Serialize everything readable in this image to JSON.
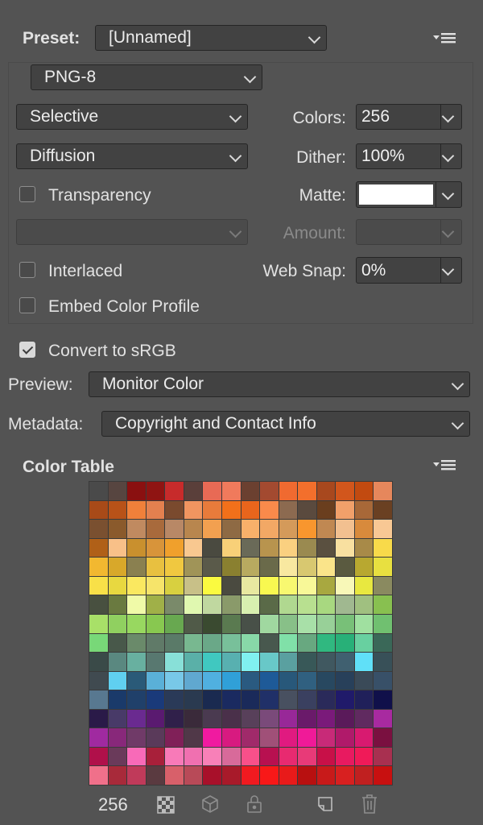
{
  "preset": {
    "label": "Preset:",
    "value": "[Unnamed]",
    "menu_icon": "panel-menu-icon"
  },
  "format": {
    "value": "PNG-8"
  },
  "reduction": {
    "value": "Selective"
  },
  "colors": {
    "label": "Colors:",
    "value": "256"
  },
  "dither_algo": {
    "value": "Diffusion"
  },
  "dither": {
    "label": "Dither:",
    "value": "100%"
  },
  "transparency": {
    "label": "Transparency",
    "checked": false
  },
  "matte": {
    "label": "Matte:",
    "color": "#ffffff"
  },
  "trans_dither": {
    "value": ""
  },
  "amount": {
    "label": "Amount:",
    "value": ""
  },
  "interlaced": {
    "label": "Interlaced",
    "checked": false
  },
  "web_snap": {
    "label": "Web Snap:",
    "value": "0%"
  },
  "embed_profile": {
    "label": "Embed Color Profile",
    "checked": false
  },
  "convert_srgb": {
    "label": "Convert to sRGB",
    "checked": true
  },
  "preview": {
    "label": "Preview:",
    "value": "Monitor Color"
  },
  "metadata": {
    "label": "Metadata:",
    "value": "Copyright and Contact Info"
  },
  "color_table": {
    "title": "Color Table",
    "count": "256",
    "colors": [
      "#4a4a4a",
      "#574540",
      "#8a1010",
      "#8f1412",
      "#c72b2b",
      "#5a3f3a",
      "#e86a55",
      "#f07a5c",
      "#6b4030",
      "#a34a30",
      "#f06a30",
      "#f36f2c",
      "#a8481e",
      "#d2561c",
      "#c24a10",
      "#e6875c",
      "#a84a18",
      "#b85218",
      "#f0803a",
      "#e3804f",
      "#7a4a2e",
      "#f09560",
      "#e87b3b",
      "#f2701a",
      "#e8651c",
      "#fa8a4b",
      "#8c6a50",
      "#5a4a3e",
      "#6a3e1e",
      "#f2a06a",
      "#a86838",
      "#6a4022",
      "#7a5030",
      "#8a5a2c",
      "#c08a60",
      "#a86a3c",
      "#b88866",
      "#b8864e",
      "#f2a050",
      "#8e6a44",
      "#f8b06a",
      "#f2a865",
      "#d49a5a",
      "#f8962e",
      "#c08852",
      "#f2c090",
      "#d88a3c",
      "#f8c894",
      "#b06018",
      "#f8c088",
      "#c9902e",
      "#d8943a",
      "#f0a02c",
      "#f8c890",
      "#4a4a40",
      "#f8d078",
      "#6a6a58",
      "#b8944e",
      "#fad080",
      "#9a8a50",
      "#5a5040",
      "#f8e0a0",
      "#a88a48",
      "#f8da4a",
      "#f2b830",
      "#d8a82a",
      "#8a8050",
      "#e8c040",
      "#f0c840",
      "#a09458",
      "#5a5a4a",
      "#8a8030",
      "#b8aa60",
      "#6a6a4a",
      "#f8e8a0",
      "#d8c870",
      "#fae48a",
      "#5a5a40",
      "#b8a830",
      "#e8e040",
      "#f8e048",
      "#e8d840",
      "#fae860",
      "#f6e46a",
      "#d8d040",
      "#c8c088",
      "#fafa40",
      "#4a4a40",
      "#e8e8a0",
      "#f8f850",
      "#f8f870",
      "#f8f898",
      "#a8a840",
      "#f8f8b8",
      "#e8e840",
      "#8a8a60",
      "#485040",
      "#6a7a40",
      "#f0faa8",
      "#a0b048",
      "#7a8a6a",
      "#e0f8b0",
      "#c0d8a0",
      "#8a9a6a",
      "#d8f0b0",
      "#5a6a48",
      "#b0d890",
      "#b8e090",
      "#a8d880",
      "#a0b890",
      "#a0c080",
      "#88c050",
      "#a8e068",
      "#90d060",
      "#98d860",
      "#88c850",
      "#68a850",
      "#505a48",
      "#3a4a30",
      "#5a7a50",
      "#485048",
      "#a0d8a0",
      "#88c088",
      "#a8e0a8",
      "#98d098",
      "#78c078",
      "#a0e0a0",
      "#70c070",
      "#78d878",
      "#48584a",
      "#6a8a6a",
      "#607a68",
      "#5a7a68",
      "#78b890",
      "#6aa888",
      "#78c09a",
      "#88d8a8",
      "#48584e",
      "#80e0a8",
      "#68a880",
      "#30b880",
      "#28b078",
      "#68d0a0",
      "#3a6858",
      "#3a4a48",
      "#5a8880",
      "#68b0a0",
      "#587870",
      "#88e0d8",
      "#5ab0a8",
      "#40c8c0",
      "#58b0b0",
      "#80f0f0",
      "#68c8c8",
      "#5aa0a0",
      "#385858",
      "#405860",
      "#406070",
      "#60e0f8",
      "#385058",
      "#404a50",
      "#60d0f0",
      "#2a5a78",
      "#5ab0d8",
      "#78c8e8",
      "#60a8d0",
      "#50b0e0",
      "#30a0d8",
      "#2a5a80",
      "#1e5a98",
      "#28587a",
      "#306080",
      "#284860",
      "#28405a",
      "#3a4a58",
      "#385068",
      "#587890",
      "#1a3a6a",
      "#20406a",
      "#1a3a7a",
      "#2a3a58",
      "#2a3a50",
      "#1a2a50",
      "#1a2a60",
      "#1a2a5a",
      "#203068",
      "#485060",
      "#3a4060",
      "#2a2a5a",
      "#201a6a",
      "#20205a",
      "#10104a",
      "#2a1a48",
      "#483a68",
      "#6a2a90",
      "#5a1a70",
      "#30204a",
      "#3a2a3a",
      "#4a3a50",
      "#4a304a",
      "#58405a",
      "#7a4a7a",
      "#982898",
      "#6a1a6a",
      "#7a1a7a",
      "#5a1a5a",
      "#602a60",
      "#a82aa0",
      "#a02aa0",
      "#88287a",
      "#703a68",
      "#5a3a5a",
      "#802058",
      "#503848",
      "#f01aa0",
      "#d81a80",
      "#a02a6a",
      "#a05078",
      "#e01a80",
      "#f01a98",
      "#c82a78",
      "#b01a6a",
      "#d81a70",
      "#7a1040",
      "#b0104a",
      "#6a3a5a",
      "#f86ab8",
      "#a8203a",
      "#f87ab8",
      "#f070b0",
      "#f880b8",
      "#d86a9a",
      "#f8508a",
      "#b81050",
      "#e82a70",
      "#e83a78",
      "#c81048",
      "#e81a60",
      "#f01a58",
      "#a83050",
      "#f0708a",
      "#a82a3a",
      "#c03a5a",
      "#5a3a40",
      "#d8606a",
      "#b84a58",
      "#a8102a",
      "#a81a2a",
      "#f01a20",
      "#f81818",
      "#e81a1a",
      "#b81010",
      "#c81a1a",
      "#d82020",
      "#c02020",
      "#c81010"
    ]
  },
  "icons": [
    "checkerboard-icon",
    "cube-icon",
    "lock-icon",
    "new-color-icon",
    "trash-icon"
  ]
}
